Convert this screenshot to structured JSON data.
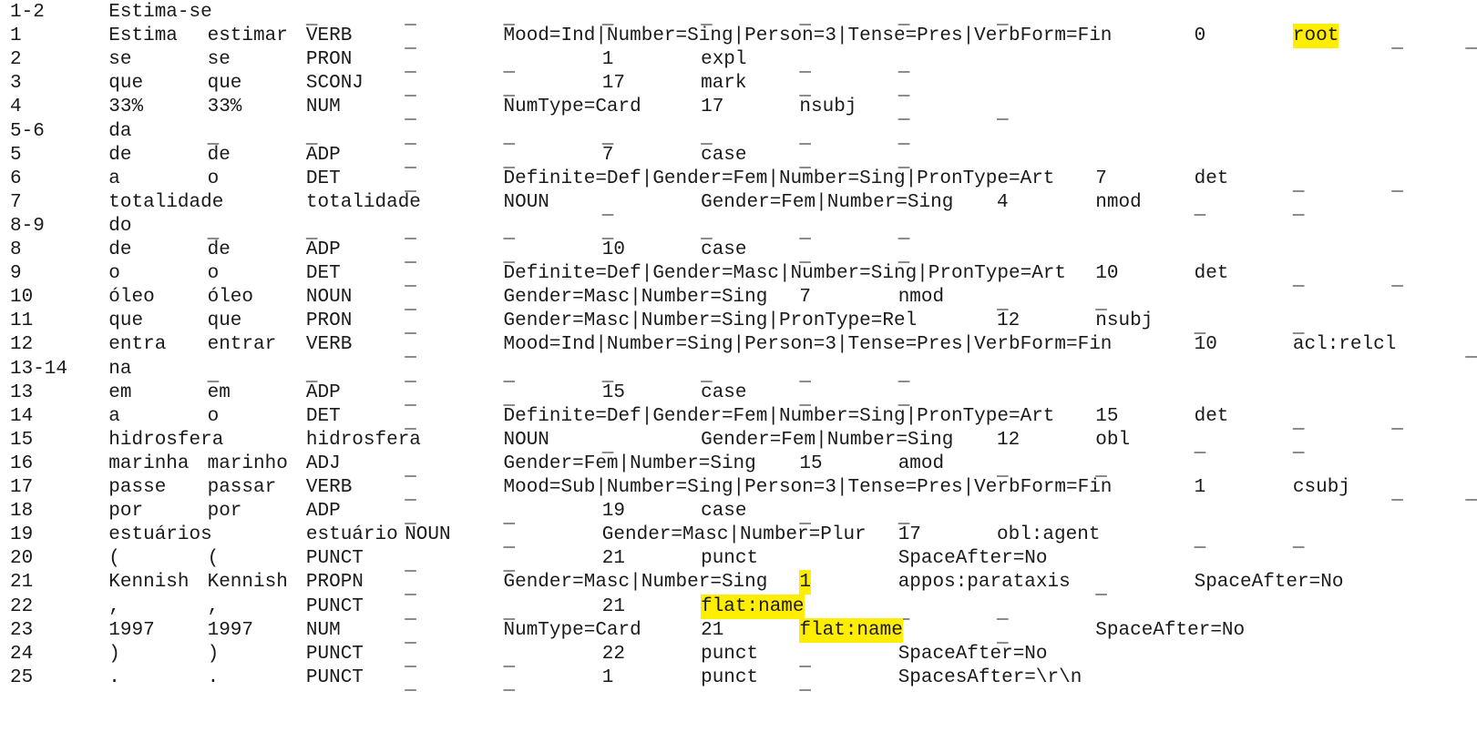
{
  "document": {
    "highlight_color": "#ffee00",
    "rows": [
      {
        "cells": [
          "1-2",
          "Estima-se",
          "_",
          "_",
          "_",
          "_",
          "_",
          "_",
          "_",
          "_"
        ]
      },
      {
        "cells": [
          "1",
          "Estima",
          "estimar",
          "VERB",
          "_",
          "Mood=Ind|Number=Sing|Person=3|Tense=Pres|VerbForm=Fin",
          "0",
          "root",
          "_",
          "_"
        ]
      },
      {
        "cells": [
          "2",
          "se",
          "se",
          "PRON",
          "_",
          "_",
          "1",
          "expl",
          "_",
          "_"
        ]
      },
      {
        "cells": [
          "3",
          "que",
          "que",
          "SCONJ",
          "_",
          "_",
          "17",
          "mark",
          "_",
          "_"
        ]
      },
      {
        "cells": [
          "4",
          "33%",
          "33%",
          "NUM",
          "_",
          "NumType=Card",
          "17",
          "nsubj",
          "_",
          "_"
        ]
      },
      {
        "cells": [
          "5-6",
          "da",
          "_",
          "_",
          "_",
          "_",
          "_",
          "_",
          "_",
          "_"
        ]
      },
      {
        "cells": [
          "5",
          "de",
          "de",
          "ADP",
          "_",
          "_",
          "7",
          "case",
          "_",
          "_"
        ]
      },
      {
        "cells": [
          "6",
          "a",
          "o",
          "DET",
          "_",
          "Definite=Def|Gender=Fem|Number=Sing|PronType=Art",
          "7",
          "det",
          "_",
          "_"
        ]
      },
      {
        "cells": [
          "7",
          "totalidade",
          "totalidade",
          "NOUN",
          "_",
          "Gender=Fem|Number=Sing",
          "4",
          "nmod",
          "_",
          "_"
        ]
      },
      {
        "cells": [
          "8-9",
          "do",
          "_",
          "_",
          "_",
          "_",
          "_",
          "_",
          "_",
          "_"
        ]
      },
      {
        "cells": [
          "8",
          "de",
          "de",
          "ADP",
          "_",
          "_",
          "10",
          "case",
          "_",
          "_"
        ]
      },
      {
        "cells": [
          "9",
          "o",
          "o",
          "DET",
          "_",
          "Definite=Def|Gender=Masc|Number=Sing|PronType=Art",
          "10",
          "det",
          "_",
          "_"
        ]
      },
      {
        "cells": [
          "10",
          "óleo",
          "óleo",
          "NOUN",
          "_",
          "Gender=Masc|Number=Sing",
          "7",
          "nmod",
          "_",
          "_"
        ]
      },
      {
        "cells": [
          "11",
          "que",
          "que",
          "PRON",
          "_",
          "Gender=Masc|Number=Sing|PronType=Rel",
          "12",
          "nsubj",
          "_",
          "_"
        ]
      },
      {
        "cells": [
          "12",
          "entra",
          "entrar",
          "VERB",
          "_",
          "Mood=Ind|Number=Sing|Person=3|Tense=Pres|VerbForm=Fin",
          "10",
          "acl:relcl",
          "_",
          "_"
        ]
      },
      {
        "cells": [
          "13-14",
          "na",
          "_",
          "_",
          "_",
          "_",
          "_",
          "_",
          "_",
          "_"
        ]
      },
      {
        "cells": [
          "13",
          "em",
          "em",
          "ADP",
          "_",
          "_",
          "15",
          "case",
          "_",
          "_"
        ]
      },
      {
        "cells": [
          "14",
          "a",
          "o",
          "DET",
          "_",
          "Definite=Def|Gender=Fem|Number=Sing|PronType=Art",
          "15",
          "det",
          "_",
          "_"
        ]
      },
      {
        "cells": [
          "15",
          "hidrosfera",
          "hidrosfera",
          "NOUN",
          "_",
          "Gender=Fem|Number=Sing",
          "12",
          "obl",
          "_",
          "_"
        ]
      },
      {
        "cells": [
          "16",
          "marinha",
          "marinho",
          "ADJ",
          "_",
          "Gender=Fem|Number=Sing",
          "15",
          "amod",
          "_",
          "_"
        ]
      },
      {
        "cells": [
          "17",
          "passe",
          "passar",
          "VERB",
          "_",
          "Mood=Sub|Number=Sing|Person=3|Tense=Pres|VerbForm=Fin",
          "1",
          "csubj",
          "_",
          "_"
        ]
      },
      {
        "cells": [
          "18",
          "por",
          "por",
          "ADP",
          "_",
          "_",
          "19",
          "case",
          "_",
          "_"
        ]
      },
      {
        "cells": [
          "19",
          "estuários",
          "estuário",
          "NOUN",
          "_",
          "Gender=Masc|Number=Plur",
          "17",
          "obl:agent",
          "_",
          "_"
        ]
      },
      {
        "cells": [
          "20",
          "(",
          "(",
          "PUNCT",
          "_",
          "_",
          "21",
          "punct",
          "_",
          "SpaceAfter=No"
        ]
      },
      {
        "cells": [
          "21",
          "Kennish",
          "Kennish",
          "PROPN",
          "_",
          "Gender=Masc|Number=Sing",
          "1",
          "appos:parataxis",
          "_",
          "SpaceAfter=No"
        ]
      },
      {
        "cells": [
          "22",
          ",",
          ",",
          "PUNCT",
          "_",
          "_",
          "21",
          "flat:name",
          "_",
          "_"
        ]
      },
      {
        "cells": [
          "23",
          "1997",
          "1997",
          "NUM",
          "_",
          "NumType=Card",
          "21",
          "flat:name",
          "_",
          "SpaceAfter=No"
        ]
      },
      {
        "cells": [
          "24",
          ")",
          ")",
          "PUNCT",
          "_",
          "_",
          "22",
          "punct",
          "_",
          "SpaceAfter=No"
        ]
      },
      {
        "cells": [
          "25",
          ".",
          ".",
          "PUNCT",
          "_",
          "_",
          "1",
          "punct",
          "_",
          "SpacesAfter=\\r\\n"
        ]
      }
    ]
  }
}
